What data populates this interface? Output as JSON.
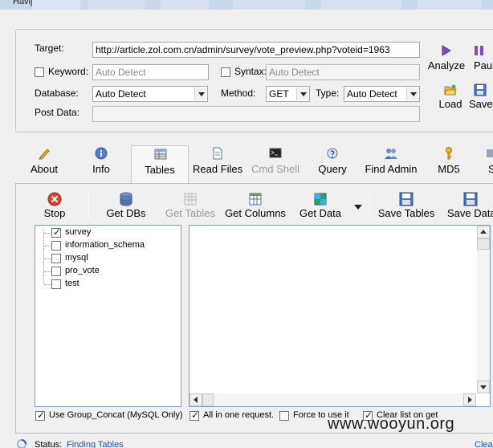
{
  "window": {
    "title": "Havij"
  },
  "target_panel": {
    "target_label": "Target:",
    "target_value": "http://article.zol.com.cn/admin/survey/vote_preview.php?voteid=1963",
    "keyword_label": "Keyword:",
    "keyword_placeholder": "Auto Detect",
    "keyword_checked": false,
    "syntax_label": "Syntax:",
    "syntax_placeholder": "Auto Detect",
    "syntax_checked": false,
    "database_label": "Database:",
    "database_value": "Auto Detect",
    "method_label": "Method:",
    "method_value": "GET",
    "type_label": "Type:",
    "type_value": "Auto Detect",
    "postdata_label": "Post Data:",
    "postdata_value": ""
  },
  "right_buttons": {
    "analyze": "Analyze",
    "pause": "Pause",
    "load": "Load",
    "save": "Save"
  },
  "tabs": [
    {
      "id": "about",
      "label": "About",
      "icon": "pen-icon"
    },
    {
      "id": "info",
      "label": "Info",
      "icon": "info-icon"
    },
    {
      "id": "tables",
      "label": "Tables",
      "icon": "table-icon",
      "selected": true
    },
    {
      "id": "read-files",
      "label": "Read Files",
      "icon": "document-icon"
    },
    {
      "id": "cmd-shell",
      "label": "Cmd Shell",
      "icon": "terminal-icon",
      "disabled": true
    },
    {
      "id": "query",
      "label": "Query",
      "icon": "query-icon"
    },
    {
      "id": "find-admin",
      "label": "Find Admin",
      "icon": "users-icon"
    },
    {
      "id": "md5",
      "label": "MD5",
      "icon": "key-icon"
    },
    {
      "id": "settings",
      "label": "S",
      "icon": "settings-icon"
    }
  ],
  "tables_toolbar": {
    "stop": "Stop",
    "get_dbs": "Get DBs",
    "get_tables": "Get Tables",
    "get_columns": "Get Columns",
    "get_data": "Get Data",
    "save_tables": "Save Tables",
    "save_data": "Save Data"
  },
  "databases": [
    {
      "name": "survey",
      "checked": true
    },
    {
      "name": "information_schema",
      "checked": false
    },
    {
      "name": "mysql",
      "checked": false
    },
    {
      "name": "pro_vote",
      "checked": false
    },
    {
      "name": "test",
      "checked": false
    }
  ],
  "options": {
    "group_concat": {
      "label": "Use Group_Concat (MySQL Only)",
      "checked": true
    },
    "all_in_one": {
      "label": "All in one request.",
      "checked": true
    },
    "force_use": {
      "label": "Force to use it",
      "checked": false
    },
    "clear_list": {
      "label": "Clear list on get",
      "checked": true
    }
  },
  "status": {
    "label": "Status:",
    "value": "Finding Tables",
    "clear": "Clear"
  },
  "watermark": "www.wooyun.org",
  "colors": {
    "stop_red": "#d9432f",
    "db_blue": "#5b7fb4",
    "save_blue": "#4a78c2",
    "link_blue": "#1f4fb4"
  }
}
